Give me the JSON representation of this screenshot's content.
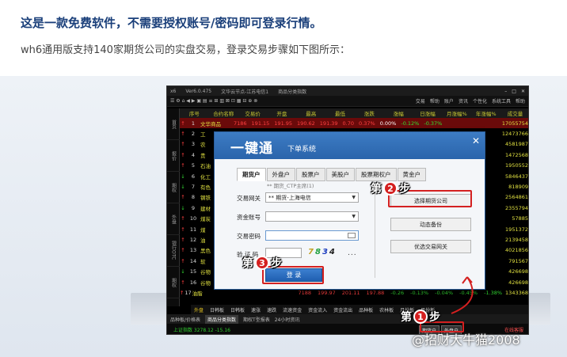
{
  "article": {
    "headline": "这是一款免费软件，不需要授权账号/密码即可登录行情。",
    "subline": "wh6通用版支持140家期货公司的实盘交易，登录交易步骤如下图所示："
  },
  "terminal": {
    "title_left": "x6",
    "title_version": "Ver6.0.475",
    "title_server": "文华云节点-江苏电信1",
    "title_page": "商品分类指数",
    "menus": [
      "交易",
      "帮助",
      "账户",
      "资讯",
      "个性化",
      "系统工具",
      "帮助"
    ],
    "columns": [
      "序号",
      "合约名称",
      "交易价",
      "开盘",
      "最高",
      "最低",
      "涨跌",
      "涨幅",
      "日涨幅",
      "月涨幅%",
      "年涨幅%",
      "成交量"
    ],
    "sidebar_tabs": [
      "首页",
      "报价",
      "期权",
      "外盘",
      "银行OTC",
      "期权"
    ],
    "first_row": {
      "num": "1",
      "name": "文华商品",
      "values": [
        "7186",
        "191.15",
        "191.95",
        "190.62",
        "191.39",
        "0.70",
        "0.37%",
        "0.00%",
        "-0.12%",
        "-0.37%"
      ],
      "volume": "17055754"
    },
    "rows": [
      {
        "num": "2",
        "name": "工",
        "volume": "12473766"
      },
      {
        "num": "3",
        "name": "农",
        "volume": "4581987"
      },
      {
        "num": "4",
        "name": "贵",
        "volume": "1472568"
      },
      {
        "num": "5",
        "name": "石油",
        "volume": "1950552"
      },
      {
        "num": "6",
        "name": "化工",
        "volume": "5846437"
      },
      {
        "num": "7",
        "name": "有色",
        "volume": "818909"
      },
      {
        "num": "8",
        "name": "钢铁",
        "volume": "2564861"
      },
      {
        "num": "9",
        "name": "建材",
        "volume": "2355794"
      },
      {
        "num": "10",
        "name": "煤炭",
        "volume": "57885"
      },
      {
        "num": "11",
        "name": "煤",
        "volume": "1951372"
      },
      {
        "num": "12",
        "name": "油",
        "volume": "2139458"
      },
      {
        "num": "13",
        "name": "黑色",
        "volume": "4021856"
      },
      {
        "num": "14",
        "name": "软",
        "volume": "791567"
      },
      {
        "num": "15",
        "name": "谷物",
        "volume": "426698"
      },
      {
        "num": "16",
        "name": "谷物",
        "volume": "426698"
      },
      {
        "num": "17",
        "name": "油脂",
        "volume": "1343368"
      }
    ],
    "last_row_values": [
      "7188",
      "199.97",
      "201.11",
      "197.88",
      "-0.26",
      "-0.13%",
      "-0.04%",
      "-0.45%",
      "-1.38%"
    ],
    "bottom_tabs": [
      "外盘",
      "日韩板",
      "日韩板",
      "速涨",
      "速跌",
      "流速资金",
      "资金流入",
      "资金流出",
      "品种板",
      "农林板",
      "月份板",
      "月份板"
    ],
    "bottom_tabs2": [
      "品种板/价格表",
      "商品分类指数",
      "期权T型报表",
      "24小时资讯"
    ],
    "status_text": "上证指数 3278.12 -15.16",
    "account_buttons": [
      "期货户",
      "外盘户"
    ],
    "online_text": "在线客服"
  },
  "dialog": {
    "title": "一键通",
    "subtitle": "下单系统",
    "close": "✕",
    "tabs": [
      "期货户",
      "外盘户",
      "股票户",
      "美股户",
      "股票期权户",
      "黄金户"
    ],
    "hint": "** 期货_CTP主席(1)",
    "labels": {
      "gateway": "交易网关",
      "account": "资金账号",
      "password": "交易密码",
      "captcha": "验 证 码"
    },
    "gateway_value": "** 期货-上海电信",
    "captcha_chars": [
      "7",
      "8",
      "3",
      "4"
    ],
    "captcha_more": "...",
    "login_button": "登 录",
    "side_buttons": [
      "选择期货公司",
      "动态备份",
      "优选交易网关"
    ]
  },
  "steps": {
    "step1": {
      "prefix": "第",
      "num": "1",
      "suffix": "步"
    },
    "step2": {
      "prefix": "第",
      "num": "2",
      "suffix": "步"
    },
    "step3": {
      "prefix": "第",
      "num": "3",
      "suffix": "步"
    }
  },
  "watermark": "@招财大牛猫2008",
  "colors": {
    "headline": "#1a3f7a",
    "dialog_blue": "#2a64ab",
    "annotation_red": "#d42020",
    "quote_yellow": "#e0e040"
  }
}
